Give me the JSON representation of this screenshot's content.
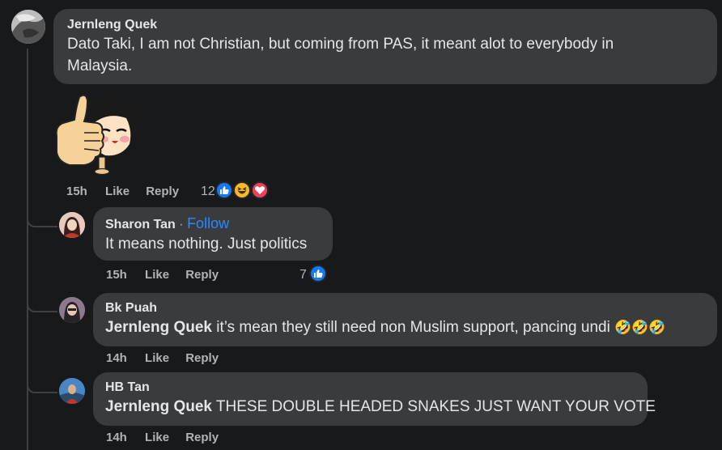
{
  "comment1": {
    "author": "Jernleng Quek",
    "text_line1": "Dato Taki, I am not Christian, but coming from PAS, it meant alot to everybody in",
    "text_line2": "Malaysia.",
    "time": "15h",
    "like": "Like",
    "reply": "Reply",
    "reaction_count": "12",
    "reactions": [
      "like-icon",
      "haha-icon",
      "love-icon"
    ]
  },
  "reply1": {
    "author": "Sharon Tan",
    "separator": "·",
    "follow": "Follow",
    "text": "It means nothing. Just politics",
    "time": "15h",
    "like": "Like",
    "reply": "Reply",
    "reaction_count": "7",
    "reactions": [
      "like-icon"
    ]
  },
  "reply2": {
    "author": "Bk Puah",
    "mention": "Jernleng Quek",
    "text": " it’s mean they still need non Muslim support, pancing undi ",
    "emojis": "🤣🤣🤣",
    "time": "14h",
    "like": "Like",
    "reply": "Reply"
  },
  "reply3": {
    "author": "HB Tan",
    "mention": "Jernleng Quek",
    "text": " THESE DOUBLE HEADED SNAKES JUST WANT YOUR VOTE",
    "time": "14h",
    "like": "Like",
    "reply": "Reply"
  },
  "colors": {
    "background": "#18191a",
    "bubble": "#3a3b3c",
    "link": "#2d88ff",
    "like_blue": "#1877f2",
    "love_red": "#f33e58",
    "haha_yellow": "#f7b928"
  }
}
